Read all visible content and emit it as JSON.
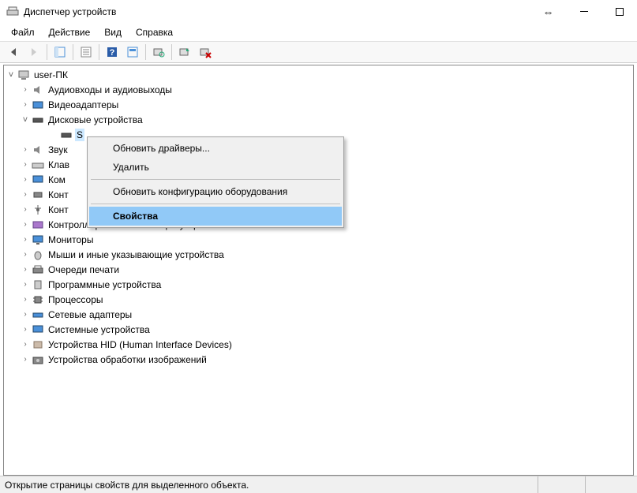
{
  "window": {
    "title": "Диспетчер устройств"
  },
  "menu": {
    "file": "Файл",
    "action": "Действие",
    "view": "Вид",
    "help": "Справка"
  },
  "tree": {
    "root": "user-ПК",
    "audio": "Аудиовходы и аудиовыходы",
    "video": "Видеоадаптеры",
    "disk": "Дисковые устройства",
    "disk_item": "S",
    "sound": "Звук",
    "keyboard": "Клав",
    "computer": "Ком",
    "controller": "Конт",
    "usb_controller": "Конт",
    "storage_controller": "Контроллеры запоминающих устройств",
    "monitor": "Мониторы",
    "mouse": "Мыши и иные указывающие устройства",
    "print": "Очереди печати",
    "software": "Программные устройства",
    "cpu": "Процессоры",
    "network": "Сетевые адаптеры",
    "system": "Системные устройства",
    "hid": "Устройства HID (Human Interface Devices)",
    "imaging": "Устройства обработки изображений"
  },
  "context_menu": {
    "update": "Обновить драйверы...",
    "delete": "Удалить",
    "scan": "Обновить конфигурацию оборудования",
    "properties": "Свойства"
  },
  "status": {
    "text": "Открытие страницы свойств для выделенного объекта."
  }
}
